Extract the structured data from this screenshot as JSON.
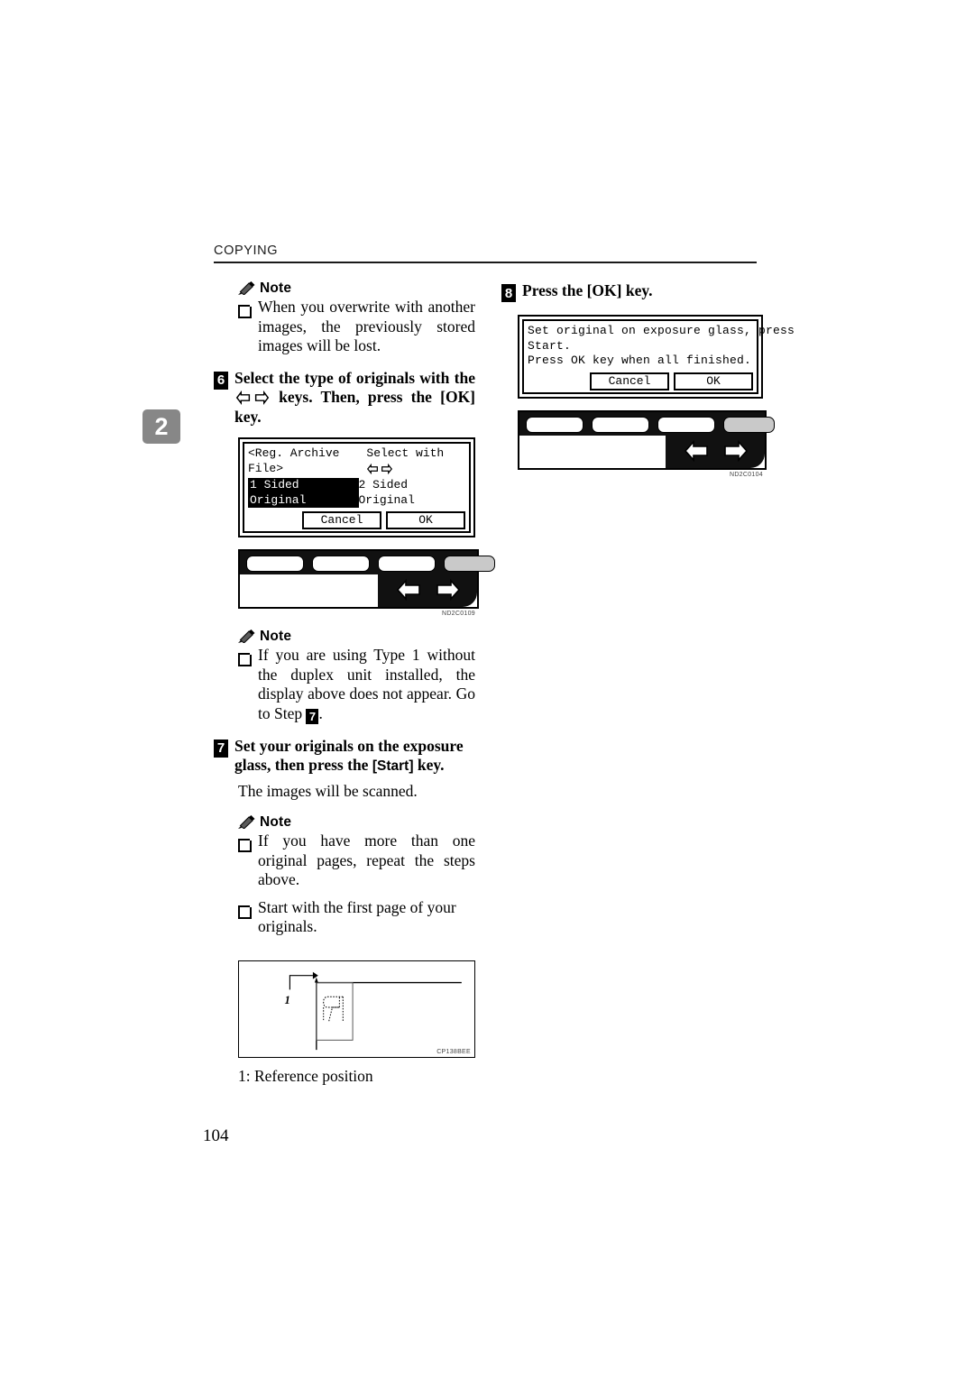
{
  "header": {
    "title": "COPYING"
  },
  "chapter_tab": {
    "number": "2"
  },
  "page_number": "104",
  "left_column": {
    "note1": {
      "label": "Note",
      "items": [
        "When you overwrite with another images, the previously stored images will be lost."
      ]
    },
    "step6": {
      "number": "6",
      "text_part1": "Select the type of originals with the",
      "text_part2": "keys. Then, press the",
      "text_part3": "[OK] key.",
      "lcd": {
        "title": "<Reg. Archive File>",
        "hint": "Select with",
        "option_selected": "1 Sided Original",
        "option_other": "2 Sided Original",
        "cancel_label": "Cancel",
        "ok_label": "OK"
      },
      "figure_code": "ND2C0109"
    },
    "note2": {
      "label": "Note",
      "item_text_a": "If you are using Type 1 without the duplex unit installed, the display above does not appear. Go to Step",
      "item_badge": "7",
      "item_text_b": "."
    },
    "step7": {
      "number": "7",
      "text_part1": "Set your originals on the exposure glass, then press the",
      "key_label": "Start",
      "text_part2": "key.",
      "body": "The images will be scanned."
    },
    "note3": {
      "label": "Note",
      "items": [
        "If you have more than one original pages, repeat the steps above.",
        "Start with the first page of your originals."
      ]
    },
    "ref_figure": {
      "marker": "1",
      "figure_code": "CP138BEE",
      "caption": "1: Reference position"
    }
  },
  "right_column": {
    "step8": {
      "number": "8",
      "text": "Press the [OK] key.",
      "lcd": {
        "line1": "Set original on exposure glass, press",
        "line2": "Start.",
        "line3": "Press OK key when all finished.",
        "cancel_label": "Cancel",
        "ok_label": "OK"
      },
      "figure_code": "ND2C0104"
    }
  },
  "icons": {
    "note": "pencil-icon",
    "left_arrow": "left-arrow-key-icon",
    "right_arrow": "right-arrow-key-icon"
  }
}
